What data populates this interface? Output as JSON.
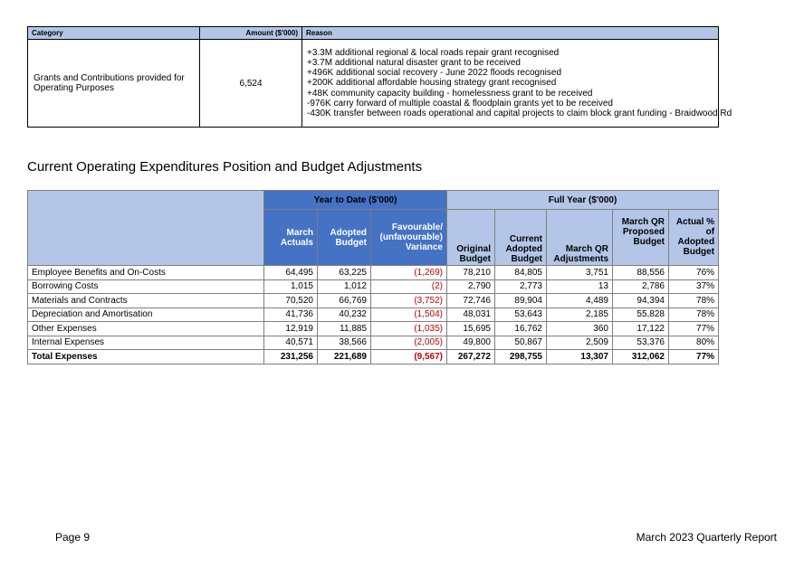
{
  "reason_table": {
    "headers": {
      "category": "Category",
      "amount": "Amount ($'000)",
      "reason": "Reason"
    },
    "row": {
      "category": "Grants and Contributions provided for Operating Purposes",
      "amount": "6,524",
      "reasons": [
        "+3.3M additional regional & local roads repair grant recognised",
        "+3.7M additional natural disaster grant to be received",
        "+496K additional social recovery - June 2022 floods recognised",
        "+200K additional affordable housing strategy grant recognised",
        "+48K community capacity building - homelessness grant to be received",
        "-976K carry forward of multiple coastal & floodplain grants yet to be received",
        "-430K transfer between roads operational and capital projects to claim block grant funding - Braidwood Rd"
      ]
    }
  },
  "section_heading": "Current Operating Expenditures Position and Budget Adjustments",
  "expenditure_table": {
    "group_headers": {
      "ytd": "Year to Date ($'000)",
      "full_year": "Full Year ($'000)"
    },
    "columns": {
      "march_actuals": "March Actuals",
      "adopted_budget": "Adopted Budget",
      "variance": "Favourable/ (unfavourable) Variance",
      "original_budget": "Original Budget",
      "current_adopted_budget": "Current Adopted Budget",
      "march_qr_adjustments": "March QR Adjustments",
      "march_qr_proposed_budget": "March QR Proposed Budget",
      "actual_pct_adopted": "Actual % of Adopted Budget"
    },
    "rows": [
      {
        "label": "Employee Benefits and On-Costs",
        "values": [
          "64,495",
          "63,225",
          "(1,269)",
          "78,210",
          "84,805",
          "3,751",
          "88,556",
          "76%"
        ]
      },
      {
        "label": "Borrowing Costs",
        "values": [
          "1,015",
          "1,012",
          "(2)",
          "2,790",
          "2,773",
          "13",
          "2,786",
          "37%"
        ]
      },
      {
        "label": "Materials and Contracts",
        "values": [
          "70,520",
          "66,769",
          "(3,752)",
          "72,746",
          "89,904",
          "4,489",
          "94,394",
          "78%"
        ]
      },
      {
        "label": "Depreciation and Amortisation",
        "values": [
          "41,736",
          "40,232",
          "(1,504)",
          "48,031",
          "53,643",
          "2,185",
          "55,828",
          "78%"
        ]
      },
      {
        "label": "Other Expenses",
        "values": [
          "12,919",
          "11,885",
          "(1,035)",
          "15,695",
          "16,762",
          "360",
          "17,122",
          "77%"
        ]
      },
      {
        "label": "Internal Expenses",
        "values": [
          "40,571",
          "38,566",
          "(2,005)",
          "49,800",
          "50,867",
          "2,509",
          "53,376",
          "80%"
        ]
      }
    ],
    "total": {
      "label": "Total Expenses",
      "values": [
        "231,256",
        "221,689",
        "(9,567)",
        "267,272",
        "298,755",
        "13,307",
        "312,062",
        "77%"
      ]
    },
    "negative_color": "#c00000",
    "ytd_header_color": "#4472c4",
    "header_color": "#b4c6e7"
  },
  "footer": {
    "page": "Page 9",
    "report": "March 2023 Quarterly Report"
  }
}
